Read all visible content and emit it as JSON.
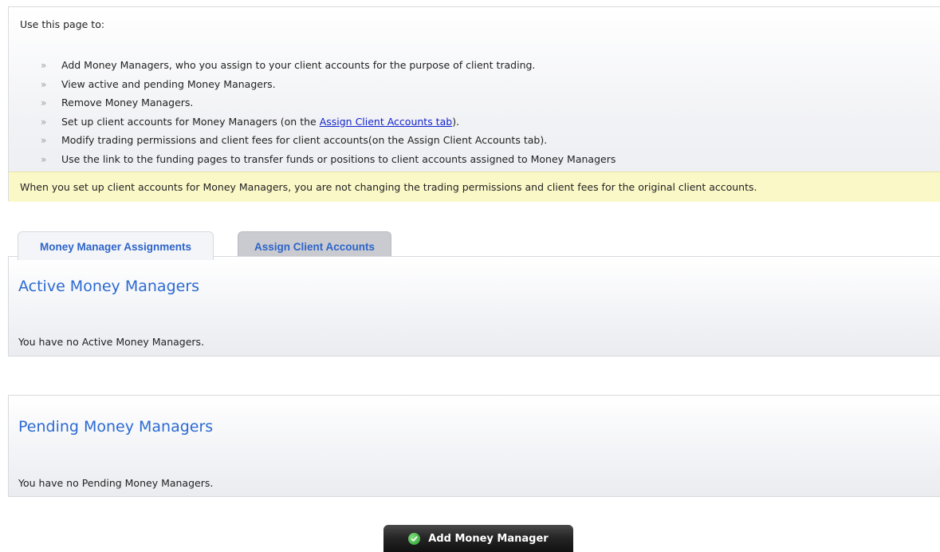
{
  "info": {
    "intro": "Use this page to:",
    "bullets": [
      {
        "text": "Add Money Managers, who you assign to your client accounts for the purpose of client trading."
      },
      {
        "text": "View active and pending Money Managers."
      },
      {
        "text": "Remove Money Managers."
      },
      {
        "before": "Set up client accounts for Money Managers (on the ",
        "link": "Assign Client Accounts tab",
        "after": ")."
      },
      {
        "text": "Modify trading permissions and client fees for client accounts(on the Assign Client Accounts tab)."
      },
      {
        "text": "Use the link to the funding pages to transfer funds or positions to client accounts assigned to Money Managers"
      }
    ],
    "bullet_marker": "»",
    "note": "When you set up client accounts for Money Managers, you are not changing the trading permissions and client fees for the original client accounts."
  },
  "tabs": [
    {
      "label": "Money Manager Assignments",
      "selected": true
    },
    {
      "label": "Assign Client Accounts",
      "selected": false
    }
  ],
  "active_section": {
    "title": "Active Money Managers",
    "empty_text": "You have no Active Money Managers."
  },
  "pending_section": {
    "title": "Pending Money Managers",
    "empty_text": "You have no Pending Money Managers."
  },
  "add_button": {
    "label": "Add Money Manager",
    "icon": "check-circle-icon"
  },
  "colors": {
    "link": "#1122cc",
    "heading": "#2b6ad2",
    "tab_text": "#2e64c9",
    "note_bg": "#fbf8c8",
    "button_bg": "#1a1a1a"
  }
}
